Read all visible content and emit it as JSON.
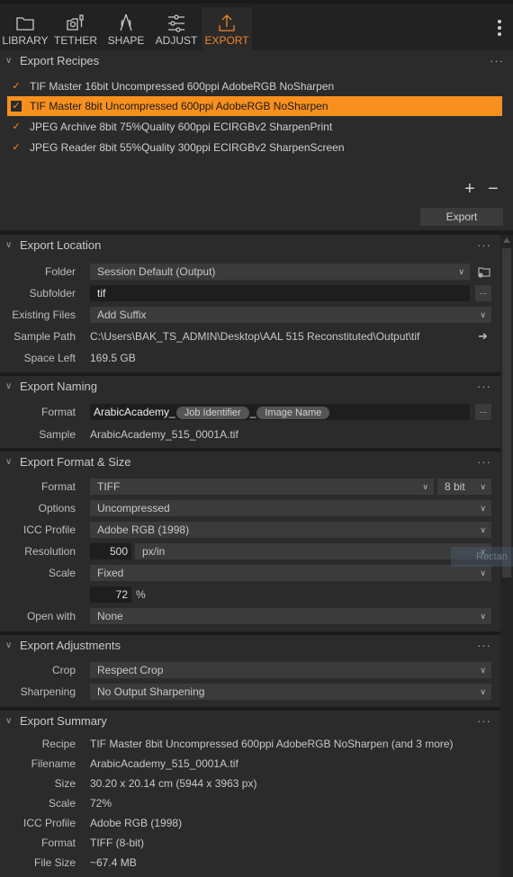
{
  "toolbar": {
    "tabs": [
      {
        "label": "LIBRARY",
        "icon": "folder-icon"
      },
      {
        "label": "TETHER",
        "icon": "camera-icon"
      },
      {
        "label": "SHAPE",
        "icon": "shape-icon"
      },
      {
        "label": "ADJUST",
        "icon": "sliders-icon"
      },
      {
        "label": "EXPORT",
        "icon": "upload-icon",
        "active": true
      }
    ],
    "accent": "#f0862a"
  },
  "recipes": {
    "title": "Export Recipes",
    "items": [
      {
        "label": "TIF Master 16bit Uncompressed 600ppi AdobeRGB NoSharpen",
        "checked": true,
        "selected": false
      },
      {
        "label": "TIF Master 8bit Uncompressed 600ppi AdobeRGB NoSharpen",
        "checked": true,
        "selected": true
      },
      {
        "label": "JPEG Archive 8bit 75%Quality 600ppi ECIRGBv2 SharpenPrint",
        "checked": true,
        "selected": false
      },
      {
        "label": "JPEG Reader 8bit 55%Quality 300ppi ECIRGBv2 SharpenScreen",
        "checked": true,
        "selected": false
      }
    ],
    "add": "+",
    "remove": "−",
    "export_label": "Export",
    "selected_color": "#f7901e"
  },
  "location": {
    "title": "Export Location",
    "folder_label": "Folder",
    "folder_value": "Session Default (Output)",
    "subfolder_label": "Subfolder",
    "subfolder_value": "tif",
    "existing_label": "Existing Files",
    "existing_value": "Add Suffix",
    "sample_path_label": "Sample Path",
    "sample_path_value": "C:\\Users\\BAK_TS_ADMIN\\Desktop\\AAL 515 Reconstituted\\Output\\tif",
    "space_left_label": "Space Left",
    "space_left_value": "169.5 GB"
  },
  "naming": {
    "title": "Export Naming",
    "format_label": "Format",
    "format_prefix": "ArabicAcademy_",
    "token1": "Job Identifier",
    "separator": "_",
    "token2": "Image Name",
    "sample_label": "Sample",
    "sample_value": "ArabicAcademy_515_0001A.tif"
  },
  "format_size": {
    "title": "Export Format & Size",
    "format_label": "Format",
    "format_value": "TIFF",
    "bit_value": "8 bit",
    "options_label": "Options",
    "options_value": "Uncompressed",
    "icc_label": "ICC Profile",
    "icc_value": "Adobe RGB (1998)",
    "resolution_label": "Resolution",
    "resolution_value": "500",
    "resolution_unit": "px/in",
    "scale_label": "Scale",
    "scale_value": "Fixed",
    "scale_percent": "72",
    "percent_sign": "%",
    "open_with_label": "Open with",
    "open_with_value": "None"
  },
  "adjustments": {
    "title": "Export Adjustments",
    "crop_label": "Crop",
    "crop_value": "Respect Crop",
    "sharpening_label": "Sharpening",
    "sharpening_value": "No Output Sharpening"
  },
  "summary": {
    "title": "Export Summary",
    "rows": [
      {
        "label": "Recipe",
        "value": "TIF Master 8bit Uncompressed 600ppi AdobeRGB NoSharpen  (and 3 more)"
      },
      {
        "label": "Filename",
        "value": "ArabicAcademy_515_0001A.tif"
      },
      {
        "label": "Size",
        "value": "30.20 x 20.14 cm (5944 x 3963 px)"
      },
      {
        "label": "Scale",
        "value": "72%"
      },
      {
        "label": "ICC Profile",
        "value": "Adobe RGB (1998)"
      },
      {
        "label": "Format",
        "value": "TIFF (8-bit)"
      },
      {
        "label": "File Size",
        "value": "~67.4 MB"
      }
    ]
  },
  "ghost_tooltip": "Rectan"
}
